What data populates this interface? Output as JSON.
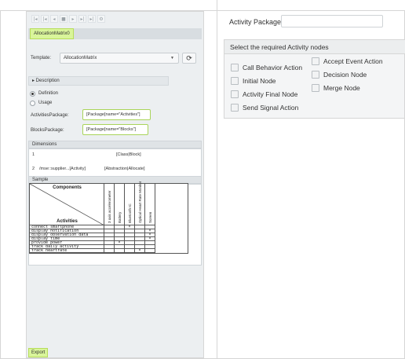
{
  "left_panel": {
    "toolbar_icons": [
      "first-icon",
      "prev-icon",
      "back-icon",
      "stop-icon",
      "forward-icon",
      "next-icon",
      "last-icon",
      "settings-icon"
    ],
    "toolbar_glyphs": [
      "|◂",
      "|◂",
      "◂",
      "■",
      "▸",
      "▸|",
      "▸|",
      "⚙"
    ],
    "tab_label": "AllocationMatrix0",
    "template_label": "Template:",
    "template_value": "AllocationMatrix",
    "description_label": "▸  Description",
    "definition_label": "Definition",
    "usage_label": "Usage",
    "activities_package_label": "ActivitiesPackage:",
    "activities_package_value": "[Package[name=\"Activities\"]",
    "blocks_package_label": "BlocksPackage:",
    "blocks_package_value": "[Package[name=\"Blocks\"]",
    "dimensions_label": "Dimensions",
    "dimension_rows": [
      {
        "index": "1",
        "path": "",
        "type": "[Class|Block]"
      },
      {
        "index": "2",
        "path": "/mse::supplier...[Activity]",
        "type": "[Abstraction|Allocate]"
      }
    ],
    "sample_label": "Sample",
    "export_label": "Export"
  },
  "matrix": {
    "components_label": "Components",
    "activities_label": "Activities",
    "columns": [
      "3 axis accelerometer",
      "Battery",
      "Bluetooth IC",
      "Optical Heart Rate Monitor",
      "Screen"
    ],
    "rows": [
      {
        "label": "connect smartphone",
        "marks": [
          "",
          "",
          "X",
          "",
          ""
        ]
      },
      {
        "label": "display notification",
        "marks": [
          "",
          "",
          "",
          "",
          "X"
        ]
      },
      {
        "label": "display observation data",
        "marks": [
          "",
          "",
          "",
          "",
          "X"
        ]
      },
      {
        "label": "display time",
        "marks": [
          "",
          "",
          "",
          "",
          "X"
        ]
      },
      {
        "label": "provide power",
        "marks": [
          "",
          "X",
          "",
          "",
          ""
        ]
      },
      {
        "label": "track daily activity",
        "marks": [
          "",
          "",
          "",
          "",
          ""
        ]
      },
      {
        "label": "track heartrate",
        "marks": [
          "",
          "",
          "",
          "X",
          ""
        ]
      }
    ]
  },
  "right_panel": {
    "activity_package_label": "Activity Package:",
    "activity_package_value": "",
    "nodes_header": "Select the required Activity nodes",
    "col1": [
      "Call Behavior Action",
      "Initial Node",
      "Activity Final Node",
      "Send Signal Action"
    ],
    "col2": [
      "Accept Event Action",
      "Decision Node",
      "Merge Node"
    ]
  }
}
